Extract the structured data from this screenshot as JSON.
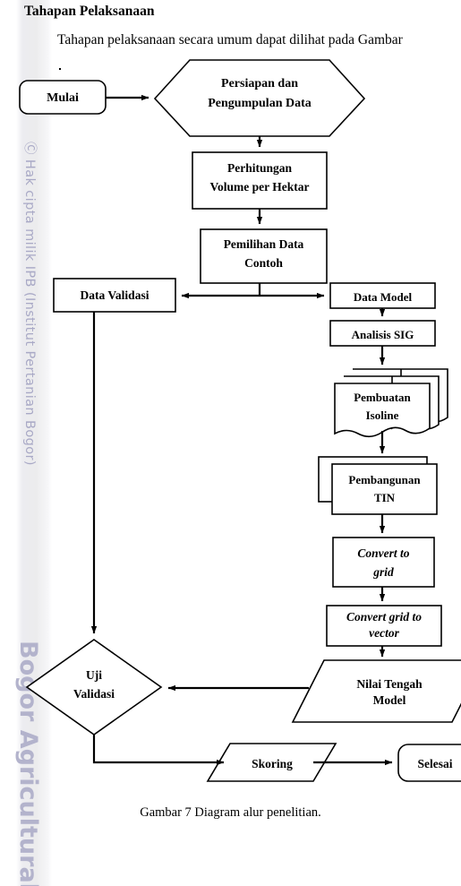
{
  "document": {
    "heading": "Tahapan Pelaksanaan",
    "paragraph": "Tahapan pelaksanaan secara umum dapat dilihat pada Gambar",
    "caption": "Gambar 7  Diagram alur penelitian."
  },
  "watermark": {
    "copyright": "Ⓒ Hak cipta milik IPB (Institut Pertanian Bogor)",
    "university": "Bogor Agricultural"
  },
  "colors": {
    "stroke": "#000000",
    "fill": "#ffffff",
    "watermark_text": "#a9a9c6",
    "watermark_strip": "#ececf0",
    "text": "#000000"
  },
  "chart_data": {
    "type": "flowchart",
    "title": "Diagram alur penelitian",
    "nodes": [
      {
        "id": "mulai",
        "label": "Mulai",
        "shape": "rounded-rectangle",
        "italic": false
      },
      {
        "id": "persiapan",
        "label": "Persiapan dan\nPengumpulan  Data",
        "shape": "hexagon",
        "italic": false
      },
      {
        "id": "perhitungan",
        "label": "Perhitungan\nVolume per Hektar",
        "shape": "rectangle",
        "italic": false
      },
      {
        "id": "pemilihan",
        "label": "Pemilihan Data\nContoh",
        "shape": "rectangle",
        "italic": false
      },
      {
        "id": "datavalidasi",
        "label": "Data Validasi",
        "shape": "rectangle",
        "italic": false
      },
      {
        "id": "datamodel",
        "label": "Data Model",
        "shape": "rectangle",
        "italic": false
      },
      {
        "id": "analisissig",
        "label": "Analisis SIG",
        "shape": "rectangle",
        "italic": false
      },
      {
        "id": "isoline",
        "label": "Pembuatan\nIsoline",
        "shape": "multi-document",
        "italic": false
      },
      {
        "id": "tin",
        "label": "Pembangunan\nTIN",
        "shape": "stacked-rectangle",
        "italic": false
      },
      {
        "id": "converttogrid",
        "label": "Convert to\ngrid",
        "shape": "rectangle",
        "italic": true
      },
      {
        "id": "convertgridtovector",
        "label": "Convert grid to\nvector",
        "shape": "rectangle",
        "italic": true
      },
      {
        "id": "nilaitengah",
        "label": "Nilai Tengah\nModel",
        "shape": "parallelogram",
        "italic": false
      },
      {
        "id": "ujivalidasi",
        "label": "Uji\nValidasi",
        "shape": "diamond",
        "italic": false
      },
      {
        "id": "skoring",
        "label": "Skoring",
        "shape": "parallelogram",
        "italic": false
      },
      {
        "id": "selesai",
        "label": "Selesai",
        "shape": "rounded-rectangle",
        "italic": false
      }
    ],
    "edges": [
      {
        "from": "mulai",
        "to": "persiapan",
        "direction": "right"
      },
      {
        "from": "persiapan",
        "to": "perhitungan",
        "direction": "down"
      },
      {
        "from": "perhitungan",
        "to": "pemilihan",
        "direction": "down"
      },
      {
        "from": "pemilihan",
        "to": "datavalidasi",
        "direction": "left"
      },
      {
        "from": "pemilihan",
        "to": "datamodel",
        "direction": "right"
      },
      {
        "from": "datamodel",
        "to": "analisissig",
        "direction": "down"
      },
      {
        "from": "analisissig",
        "to": "isoline",
        "direction": "down"
      },
      {
        "from": "isoline",
        "to": "tin",
        "direction": "down"
      },
      {
        "from": "tin",
        "to": "converttogrid",
        "direction": "down"
      },
      {
        "from": "converttogrid",
        "to": "convertgridtovector",
        "direction": "down"
      },
      {
        "from": "convertgridtovector",
        "to": "nilaitengah",
        "direction": "down"
      },
      {
        "from": "nilaitengah",
        "to": "ujivalidasi",
        "direction": "left"
      },
      {
        "from": "datavalidasi",
        "to": "ujivalidasi",
        "direction": "down"
      },
      {
        "from": "ujivalidasi",
        "to": "skoring",
        "direction": "down-right"
      },
      {
        "from": "skoring",
        "to": "selesai",
        "direction": "right"
      }
    ]
  },
  "labels": {
    "mulai": "Mulai",
    "persiapan_line1": "Persiapan dan",
    "persiapan_line2": "Pengumpulan  Data",
    "perhitungan_line1": "Perhitungan",
    "perhitungan_line2": "Volume per Hektar",
    "pemilihan_line1": "Pemilihan Data",
    "pemilihan_line2": "Contoh",
    "datavalidasi": "Data Validasi",
    "datamodel": "Data Model",
    "analisissig": "Analisis SIG",
    "isoline_line1": "Pembuatan",
    "isoline_line2": "Isoline",
    "tin_line1": "Pembangunan",
    "tin_line2": "TIN",
    "converttogrid_line1": "Convert to",
    "converttogrid_line2": "grid",
    "convertgridtovector_line1": "Convert grid to",
    "convertgridtovector_line2": "vector",
    "nilaitengah_line1": "Nilai Tengah",
    "nilaitengah_line2": "Model",
    "ujivalidasi_line1": "Uji",
    "ujivalidasi_line2": "Validasi",
    "skoring": "Skoring",
    "selesai": "Selesai"
  }
}
